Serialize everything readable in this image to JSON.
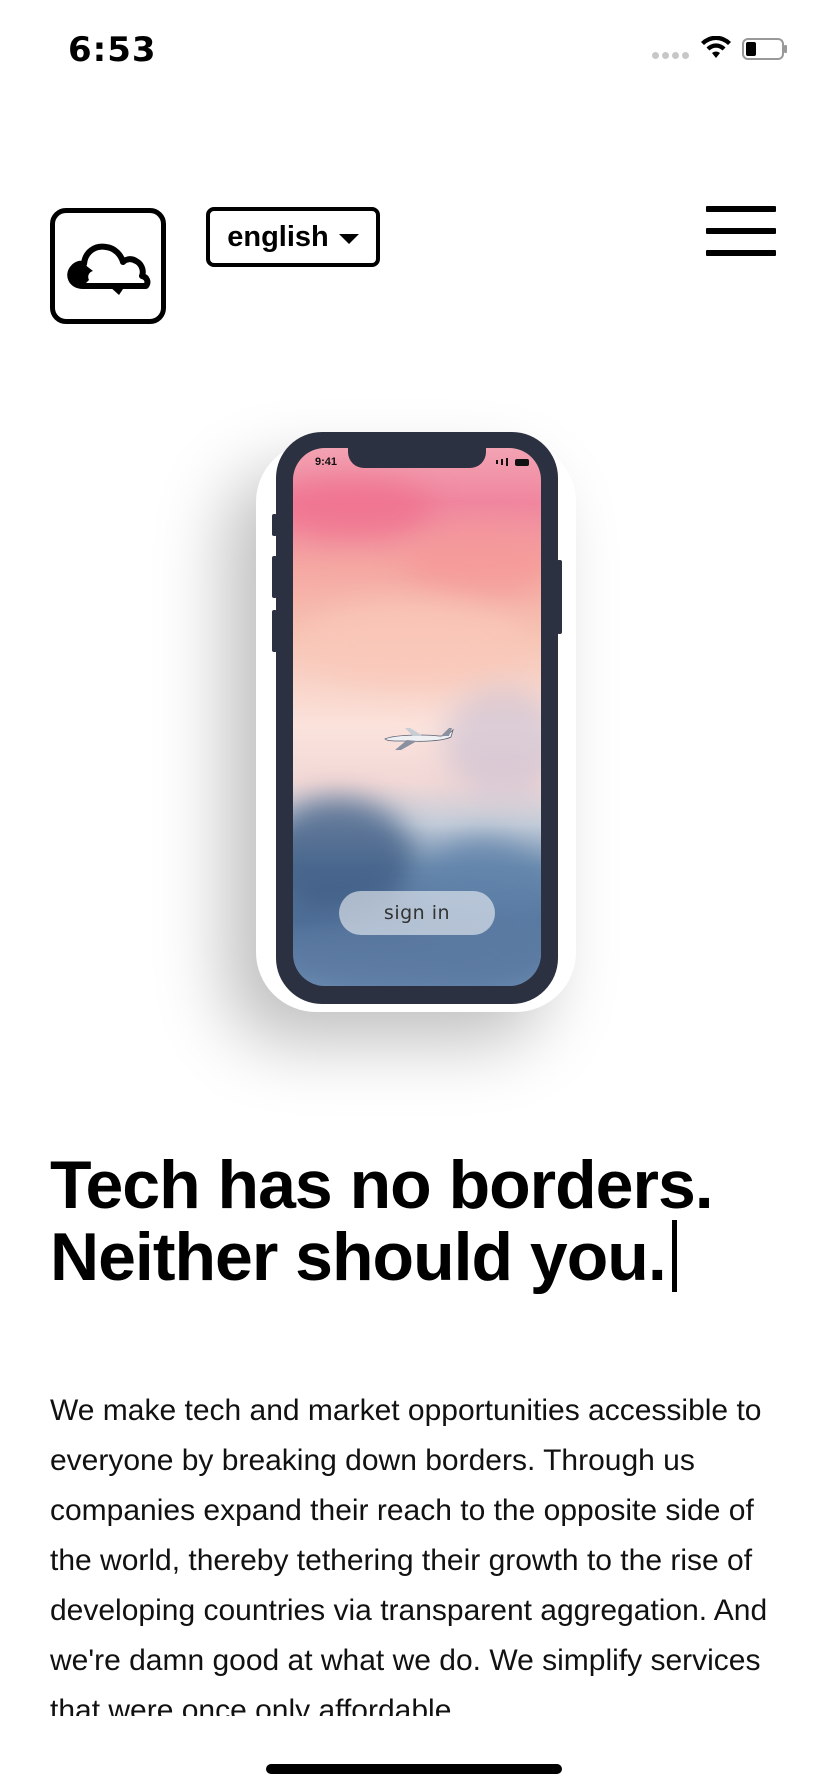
{
  "status_bar": {
    "time": "6:53",
    "icons": [
      "cellular-signal-icon",
      "wifi-icon",
      "battery-icon"
    ]
  },
  "header": {
    "logo_icon": "cloud-logo-icon",
    "language": "english",
    "menu_icon": "hamburger-menu-icon"
  },
  "phone_mockup": {
    "time": "9:41",
    "button_label": "sign in",
    "image_subject": "airplane-in-sky-icon"
  },
  "hero": {
    "headline_line1": "Tech has no borders.",
    "headline_line2": "Neither should you."
  },
  "body": {
    "paragraph": "We make tech and market opportunities accessible to everyone by breaking down borders. Through us companies expand their reach to the opposite side of the world, thereby tethering their growth to the rise of developing countries via transparent aggregation. And we're damn good at what we do. We simplify services that were once only affordable"
  },
  "colors": {
    "text": "#000000",
    "background": "#ffffff",
    "phone_frame": "#2b3140"
  }
}
